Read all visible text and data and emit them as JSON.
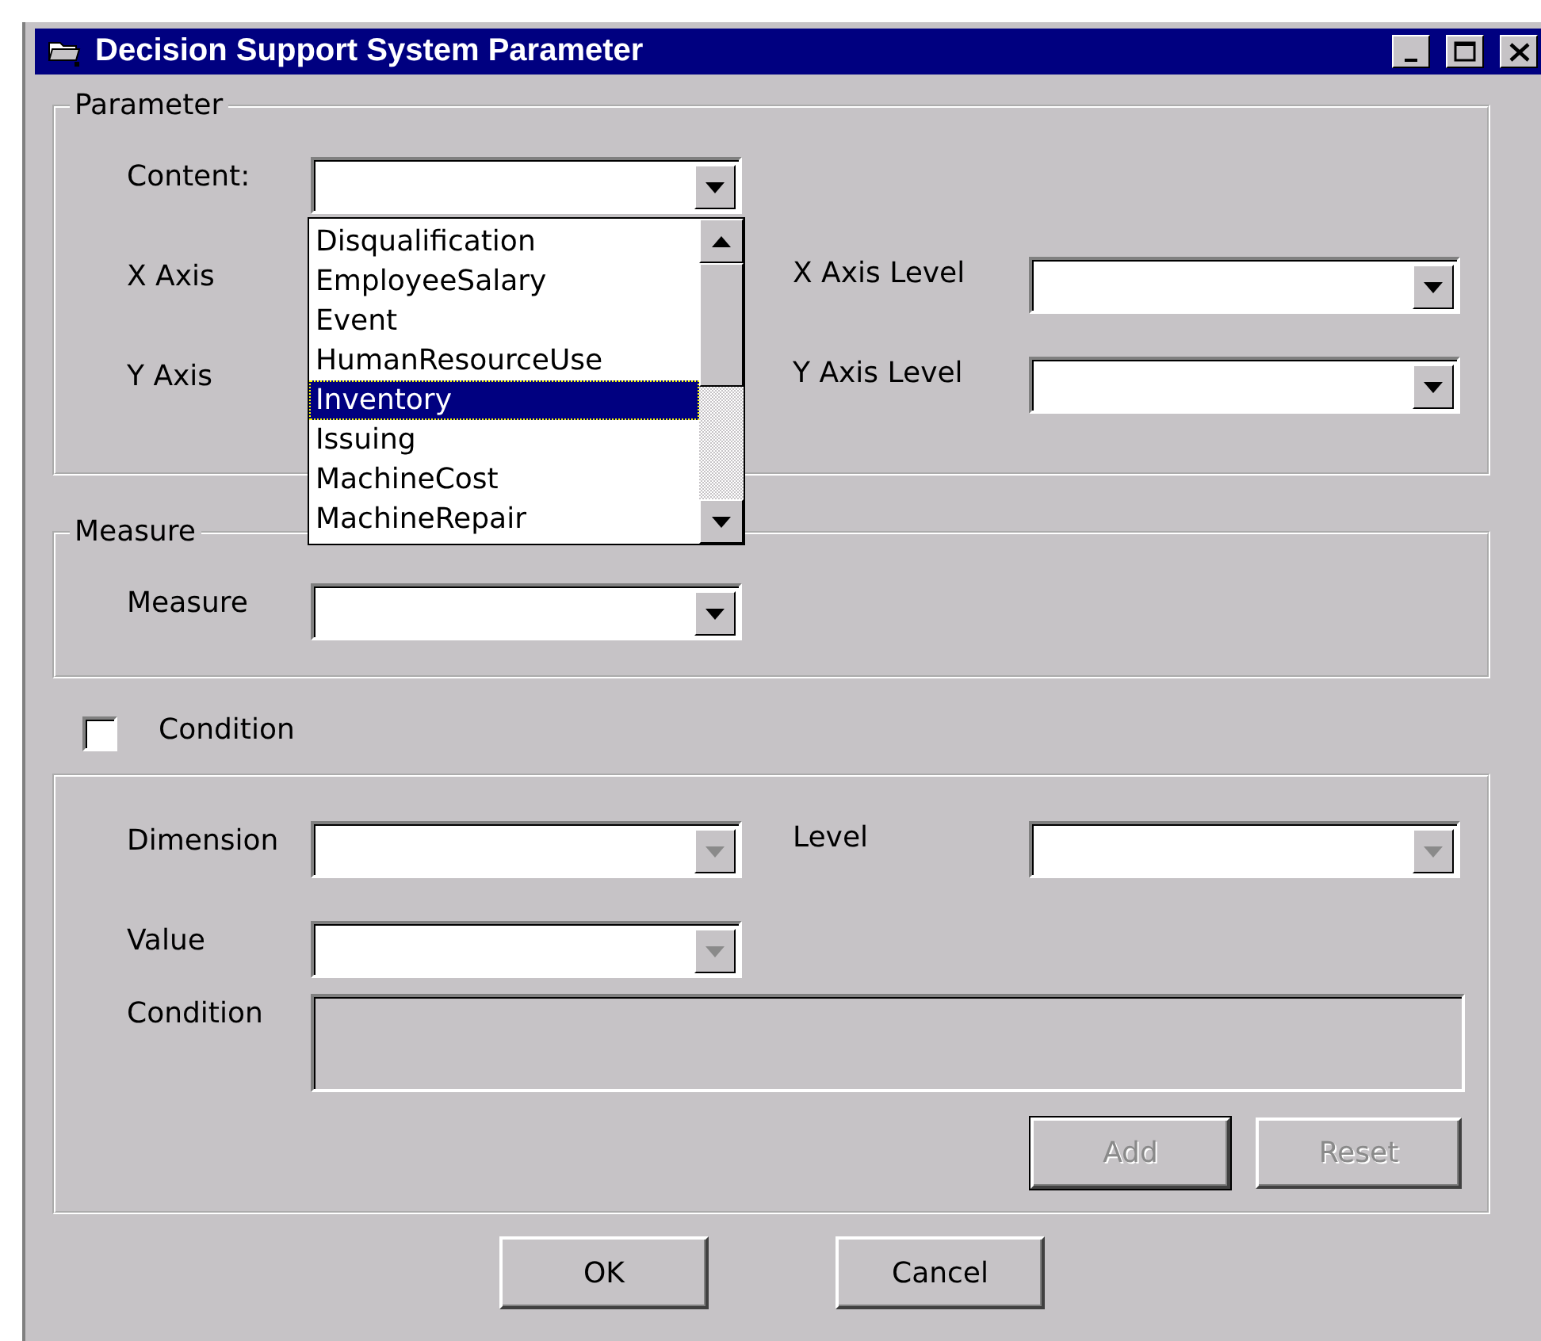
{
  "window": {
    "title": "Decision Support System Parameter"
  },
  "parameter_group": {
    "legend": "Parameter",
    "rows": [
      [
        {
          "label": "Content:",
          "disabled": false
        }
      ],
      [
        {
          "label": "X Axis"
        },
        {
          "label": "X Axis Level",
          "disabled": false
        }
      ],
      [
        {
          "label": "Y Axis"
        },
        {
          "label": "Y Axis Level",
          "disabled": false
        }
      ]
    ],
    "open_list": {
      "options": [
        {
          "text": "Disqualification",
          "selected": false
        },
        {
          "text": "EmployeeSalary",
          "selected": false
        },
        {
          "text": "Event",
          "selected": false
        },
        {
          "text": "HumanResourceUse",
          "selected": false
        },
        {
          "text": "Inventory",
          "selected": true
        },
        {
          "text": "Issuing",
          "selected": false
        },
        {
          "text": "MachineCost",
          "selected": false
        },
        {
          "text": "MachineRepair",
          "selected": false
        }
      ]
    }
  },
  "measure_group": {
    "legend": "Measure",
    "rows": [
      [
        {
          "label": "Measure",
          "disabled": false
        }
      ]
    ]
  },
  "condition_checkbox": {
    "label": "Condition",
    "checked": false
  },
  "condition_group": {
    "rows": [
      [
        {
          "label": "Dimension",
          "disabled": true
        },
        {
          "label": "Level",
          "disabled": true
        }
      ],
      [
        {
          "label": "Value",
          "disabled": true
        }
      ]
    ],
    "condition_box": {
      "label": "Condition",
      "disabled": true
    },
    "buttons": [
      {
        "label": "Add",
        "disabled": true,
        "default": true
      },
      {
        "label": "Reset",
        "disabled": true,
        "default": false
      }
    ]
  },
  "buttons": [
    {
      "label": "OK",
      "disabled": false,
      "default": false
    },
    {
      "label": "Cancel",
      "disabled": false,
      "default": false
    }
  ]
}
